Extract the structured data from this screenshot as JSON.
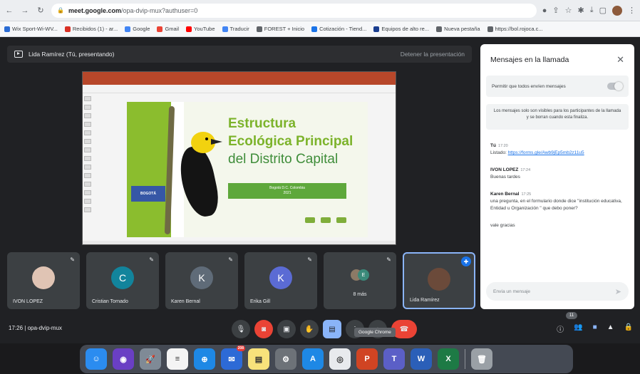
{
  "browser": {
    "url_host": "meet.google.com",
    "url_path": "/opa-dvip-mux?authuser=0",
    "bookmarks": [
      {
        "label": "Wix Sport-Wi-WV...",
        "color": "#2b6cd4"
      },
      {
        "label": "Recibidos (1) - ar...",
        "color": "#d93025"
      },
      {
        "label": "Google",
        "color": "#4285f4"
      },
      {
        "label": "Gmail",
        "color": "#ea4335"
      },
      {
        "label": "YouTube",
        "color": "#ff0000"
      },
      {
        "label": "Traducir",
        "color": "#4285f4"
      },
      {
        "label": "FOREST + Inicio",
        "color": "#5f6368"
      },
      {
        "label": "Cotización - Tiend...",
        "color": "#1a73e8"
      },
      {
        "label": "Equipos de alto re...",
        "color": "#1a3d8f"
      },
      {
        "label": "Nueva pestaña",
        "color": "#5f6368"
      },
      {
        "label": "https://bol.rojoca.c...",
        "color": "#5f6368"
      }
    ]
  },
  "presentation": {
    "presenter_label": "Lida Ramírez (Tú, presentando)",
    "stop_label": "Detener la presentación"
  },
  "slide": {
    "title_line1": "Estructura",
    "title_line2": "Ecológica Principal",
    "title_line3": "del Distrito Capital",
    "subtitle_line1": "Bogotá D.C. Colombia",
    "subtitle_line2": "2021",
    "logo_text": "BOGOTÁ"
  },
  "participants": [
    {
      "name": "IVON LOPEZ",
      "initial": "",
      "color": "#e0c4b4"
    },
    {
      "name": "Cristian Tornado",
      "initial": "C",
      "color": "#12849c"
    },
    {
      "name": "Karen Bernal",
      "initial": "K",
      "color": "#5f6b78"
    },
    {
      "name": "Erika Gill",
      "initial": "K",
      "color": "#5b6bd4"
    },
    {
      "name": "8 más",
      "initial": "E",
      "color": "#3b8a7a"
    },
    {
      "name": "Lida Ramírez",
      "initial": "",
      "color": "#6b4a3a"
    }
  ],
  "chat": {
    "title": "Mensajes en la llamada",
    "toggle_label": "Permitir que todos envíen mensajes",
    "notice": "Los mensajes solo son visibles para los participantes de la llamada y se borran cuando esta finaliza.",
    "messages": [
      {
        "sender": "Tú",
        "time": "17:20",
        "text": "Listado:",
        "link": "https://forms.gle/Awb9jEp5mb2z11u5"
      },
      {
        "sender": "IVON LOPEZ",
        "time": "17:24",
        "text": "Buenas tardes",
        "link": ""
      },
      {
        "sender": "Karen Bernal",
        "time": "17:25",
        "text": "una pregunta, en el formulario donde dice \"institución educativa, Entidad u Organización \" que debo poner?",
        "link": ""
      },
      {
        "sender": "",
        "time": "",
        "text": "vale gracias",
        "link": ""
      }
    ],
    "compose_placeholder": "Envía un mensaje"
  },
  "controls": {
    "time": "17:26",
    "meeting_code": "opa-dvip-mux",
    "tooltip": "Google Chrome",
    "participants_count": "11"
  },
  "dock": {
    "apps": [
      {
        "name": "Finder",
        "color": "#2b8cf0",
        "glyph": "☺"
      },
      {
        "name": "Siri",
        "color": "#6a3fc4",
        "glyph": "◉"
      },
      {
        "name": "Launchpad",
        "color": "#7f8a96",
        "glyph": "🚀"
      },
      {
        "name": "Notes",
        "color": "#f4f4f4",
        "glyph": "≡"
      },
      {
        "name": "Safari",
        "color": "#1e88e5",
        "glyph": "⊕"
      },
      {
        "name": "Mail",
        "color": "#2d6ad6",
        "glyph": "✉",
        "badge": "208"
      },
      {
        "name": "Notes2",
        "color": "#f7e27b",
        "glyph": "▤"
      },
      {
        "name": "System Preferences",
        "color": "#6d7278",
        "glyph": "⚙"
      },
      {
        "name": "App Store",
        "color": "#1e88e5",
        "glyph": "A"
      },
      {
        "name": "Chrome",
        "color": "#e8eaed",
        "glyph": "◎"
      },
      {
        "name": "PowerPoint",
        "color": "#d04423",
        "glyph": "P"
      },
      {
        "name": "Teams",
        "color": "#5b5fc7",
        "glyph": "T"
      },
      {
        "name": "Word",
        "color": "#2b5fb8",
        "glyph": "W"
      },
      {
        "name": "Excel",
        "color": "#1d7a45",
        "glyph": "X"
      },
      {
        "name": "Trash",
        "color": "#9aa0a6",
        "glyph": "🗑"
      }
    ]
  }
}
